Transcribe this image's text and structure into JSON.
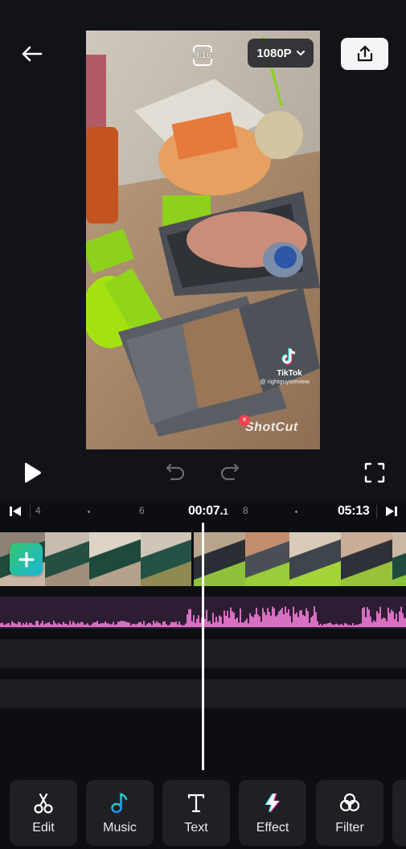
{
  "header": {
    "back_icon": "arrow-left-icon",
    "export_icon": "share-upload-icon"
  },
  "preview": {
    "aspect_ratio": "9:16",
    "resolution": "1080P",
    "resolution_icon": "chevron-down-icon",
    "tiktok_brand": "TikTok",
    "tiktok_handle": "@ rightguysreview",
    "watermark": "ShotCut",
    "watermark_close": "×"
  },
  "controls": {
    "play_icon": "play-icon",
    "undo_icon": "undo-icon",
    "redo_icon": "redo-icon",
    "fullscreen_icon": "fullscreen-icon"
  },
  "ruler": {
    "ticks": [
      "4",
      "6",
      "8"
    ],
    "current_time": "00:07.",
    "current_time_frac": "1",
    "total_time": "05:13"
  },
  "timeline": {
    "add_clip_label": "+",
    "accent_audio_color": "#d86fc0",
    "audio_bg_color": "#2d1d33"
  },
  "toolbar": {
    "items": [
      {
        "label": "Edit",
        "icon": "scissors-icon"
      },
      {
        "label": "Music",
        "icon": "music-note-icon"
      },
      {
        "label": "Text",
        "icon": "text-icon"
      },
      {
        "label": "Effect",
        "icon": "lightning-icon"
      },
      {
        "label": "Filter",
        "icon": "filter-circles-icon"
      },
      {
        "label": "",
        "icon": "more-tool-icon"
      }
    ]
  }
}
